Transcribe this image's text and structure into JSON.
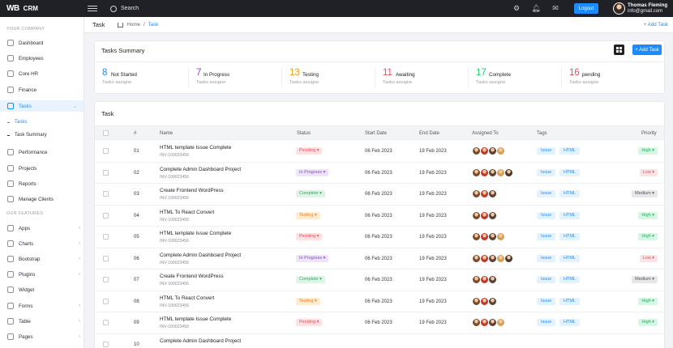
{
  "topbar": {
    "logo": "WB",
    "app_name": "CRM",
    "search_placeholder": "Search",
    "logout_label": "Logout",
    "user_name": "Thomas Fleming",
    "user_email": "info@gmail.com"
  },
  "sidebar": {
    "section_company": "YOUR COMPANY",
    "section_features": "OUR FEATURES",
    "items": [
      {
        "label": "Dashboard"
      },
      {
        "label": "Employees"
      },
      {
        "label": "Core HR"
      },
      {
        "label": "Finance"
      },
      {
        "label": "Tasks"
      },
      {
        "label": "Performance"
      },
      {
        "label": "Projects"
      },
      {
        "label": "Reports"
      },
      {
        "label": "Manage Clients"
      },
      {
        "label": "Apps"
      },
      {
        "label": "Charts"
      },
      {
        "label": "Bootstrap"
      },
      {
        "label": "Plugins"
      },
      {
        "label": "Widget"
      },
      {
        "label": "Forms"
      },
      {
        "label": "Table"
      },
      {
        "label": "Pages"
      }
    ],
    "subitems": [
      {
        "label": "Tasks"
      },
      {
        "label": "Task Summary"
      }
    ]
  },
  "breadcrumb": {
    "page_title": "Task",
    "home": "Home",
    "separator": "/",
    "current": "Task",
    "add_link": "+ Add Task"
  },
  "summary": {
    "title": "Tasks Summary",
    "add_button": "+ Add Task",
    "stats": [
      {
        "count": "8",
        "label": "Not Started",
        "sub": "Tasks assigne",
        "color": "#1a8cff"
      },
      {
        "count": "7",
        "label": "In Progress",
        "sub": "Tasks assigne",
        "color": "#8e44d6"
      },
      {
        "count": "13",
        "label": "Testing",
        "sub": "Tasks assigne",
        "color": "#f39c12"
      },
      {
        "count": "11",
        "label": "Awaiting",
        "sub": "Tasks assigne",
        "color": "#e74c5c"
      },
      {
        "count": "17",
        "label": "Complete",
        "sub": "Tasks assigne",
        "color": "#2ecc71"
      },
      {
        "count": "16",
        "label": "pending",
        "sub": "Tasks assigne",
        "color": "#e74c5c"
      }
    ]
  },
  "tasks": {
    "title": "Task",
    "headers": {
      "num": "#",
      "name": "Name",
      "status": "Status",
      "start": "Start Date",
      "end": "End Date",
      "assigned": "Assigned To",
      "tags": "Tags",
      "priority": "Priority"
    },
    "rows": [
      {
        "num": "01",
        "name": "HTML template Issue Complete",
        "id": "INV-100023456",
        "status": "Pending",
        "start": "06 Feb 2023",
        "end": "19 Feb 2023",
        "tag1": "Issue",
        "tag2": "HTML",
        "priority": "High"
      },
      {
        "num": "02",
        "name": "Complete Admin Dashboard Project",
        "id": "INV-100023456",
        "status": "In Progress",
        "start": "06 Feb 2023",
        "end": "19 Feb 2023",
        "tag1": "Issue",
        "tag2": "HTML",
        "priority": "Low"
      },
      {
        "num": "03",
        "name": "Create Frontend WordPress",
        "id": "INV-100023456",
        "status": "Complete",
        "start": "06 Feb 2023",
        "end": "19 Feb 2023",
        "tag1": "Issue",
        "tag2": "HTML",
        "priority": "Medium"
      },
      {
        "num": "04",
        "name": "HTML To React Convert",
        "id": "INV-100023456",
        "status": "Testing",
        "start": "06 Feb 2023",
        "end": "19 Feb 2023",
        "tag1": "Issue",
        "tag2": "HTML",
        "priority": "High"
      },
      {
        "num": "05",
        "name": "HTML template Issue Complete",
        "id": "INV-100023456",
        "status": "Pending",
        "start": "06 Feb 2023",
        "end": "19 Feb 2023",
        "tag1": "Issue",
        "tag2": "HTML",
        "priority": "High"
      },
      {
        "num": "06",
        "name": "Complete Admin Dashboard Project",
        "id": "INV-100023456",
        "status": "In Progress",
        "start": "06 Feb 2023",
        "end": "19 Feb 2023",
        "tag1": "Issue",
        "tag2": "HTML",
        "priority": "Low"
      },
      {
        "num": "07",
        "name": "Create Frontend WordPress",
        "id": "INV-100023456",
        "status": "Complete",
        "start": "06 Feb 2023",
        "end": "19 Feb 2023",
        "tag1": "Issue",
        "tag2": "HTML",
        "priority": "Medium"
      },
      {
        "num": "08",
        "name": "HTML To React Convert",
        "id": "INV-100023456",
        "status": "Testing",
        "start": "06 Feb 2023",
        "end": "19 Feb 2023",
        "tag1": "Issue",
        "tag2": "HTML",
        "priority": "High"
      },
      {
        "num": "09",
        "name": "HTML template Issue Complete",
        "id": "INV-100023456",
        "status": "Pending",
        "start": "06 Feb 2023",
        "end": "19 Feb 2023",
        "tag1": "Issue",
        "tag2": "HTML",
        "priority": "High"
      },
      {
        "num": "10",
        "name": "Complete Admin Dashboard Project",
        "id": "",
        "status": "",
        "start": "",
        "end": "",
        "tag1": "",
        "tag2": "",
        "priority": ""
      }
    ]
  },
  "colors": {
    "accent": "#1a8cff",
    "topbar_bg": "#1f2126",
    "pending_bg": "#fde2e4",
    "pending_fg": "#e74c5c",
    "progress_bg": "#efe3fb",
    "progress_fg": "#8e44d6",
    "complete_bg": "#dcf6e6",
    "complete_fg": "#27ae60",
    "testing_bg": "#fdebd3",
    "testing_fg": "#e67e22",
    "high_bg": "#d9f5e5",
    "high_fg": "#27ae60",
    "low_bg": "#fde2e4",
    "low_fg": "#e74c5c",
    "medium_bg": "#e6e7ea",
    "medium_fg": "#555"
  }
}
